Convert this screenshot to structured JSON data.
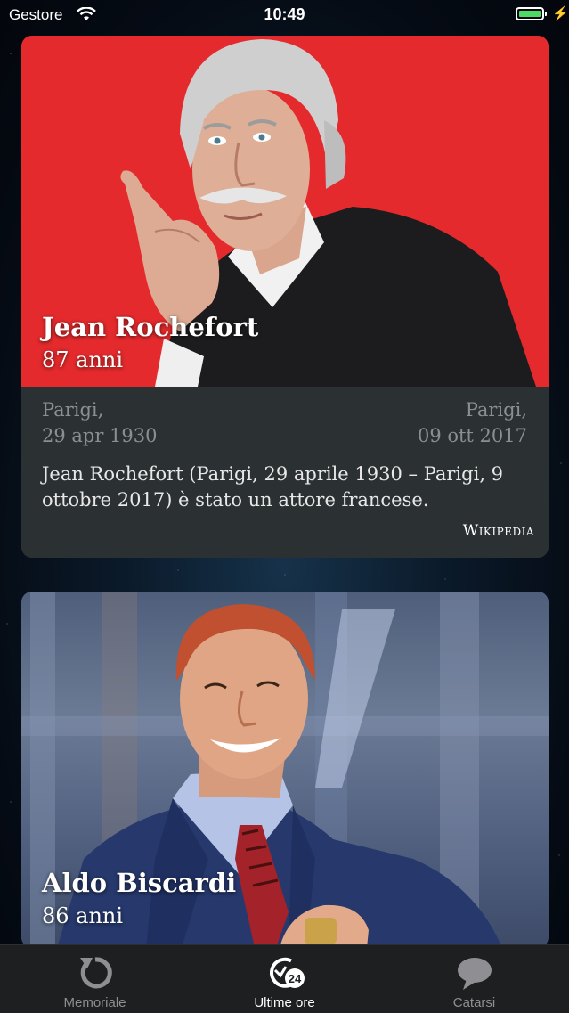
{
  "status_bar": {
    "carrier": "Gestore",
    "time": "10:49",
    "battery_level": 1.0,
    "charging_symbol": "⚡"
  },
  "cards": [
    {
      "name": "Jean Rochefort",
      "age": "87 anni",
      "birth_place": "Parigi,",
      "birth_date": "29 apr 1930",
      "death_place": "Parigi,",
      "death_date": "09 ott 2017",
      "summary": "Jean Rochefort (Parigi, 29 aprile 1930 – Parigi, 9 ottobre 2017) è stato un attore francese.",
      "source": "Wikipedia",
      "photo_background": "#e42a2c"
    },
    {
      "name": "Aldo Biscardi",
      "age": "86 anni"
    }
  ],
  "tab_bar": {
    "tabs": [
      {
        "label": "Memoriale",
        "icon": "refresh-icon",
        "selected": false
      },
      {
        "label": "Ultime ore",
        "icon": "clock-24-icon",
        "selected": true
      },
      {
        "label": "Catarsi",
        "icon": "chat-bubble-icon",
        "selected": false
      }
    ],
    "active_color": "#ffffff",
    "inactive_color": "#8e8e93"
  }
}
